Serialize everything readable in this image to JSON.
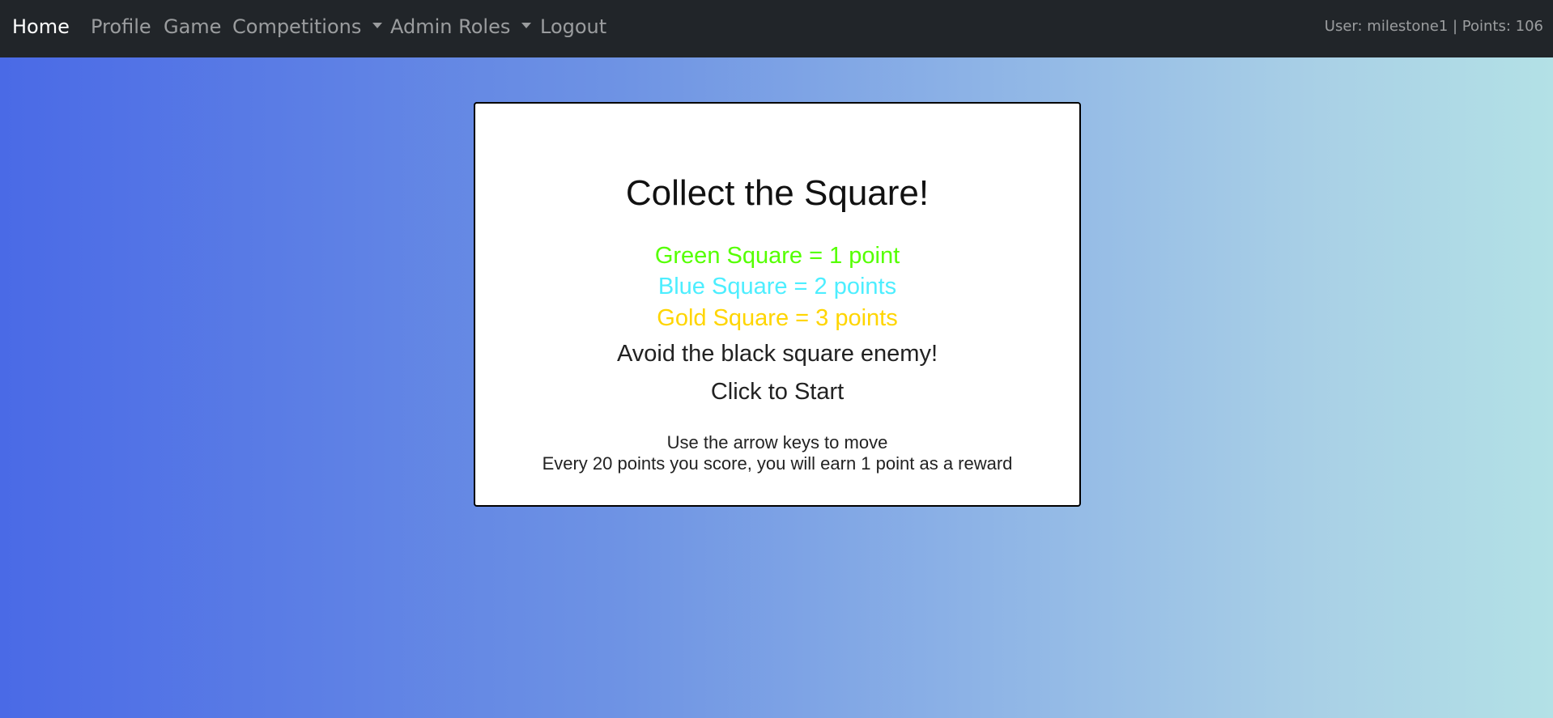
{
  "nav": {
    "items": [
      {
        "label": "Home"
      },
      {
        "label": "Profile"
      },
      {
        "label": "Game"
      },
      {
        "label": "Competitions"
      },
      {
        "label": "Admin Roles"
      },
      {
        "label": "Logout"
      }
    ],
    "user_info": "User: milestone1 | Points: 106"
  },
  "game": {
    "title": "Collect the Square!",
    "green_rule": "Green Square = 1 point",
    "blue_rule": "Blue Square = 2 points",
    "gold_rule": "Gold Square = 3 points",
    "warning": "Avoid the black square enemy!",
    "start_prompt": "Click to Start",
    "help_move": "Use the arrow keys to move",
    "help_reward": "Every 20 points you score, you will earn 1 point as a reward"
  },
  "colors": {
    "navbar": "#212529",
    "green": "#55ff00",
    "blue": "#4deeff",
    "gold": "#ffd500"
  }
}
